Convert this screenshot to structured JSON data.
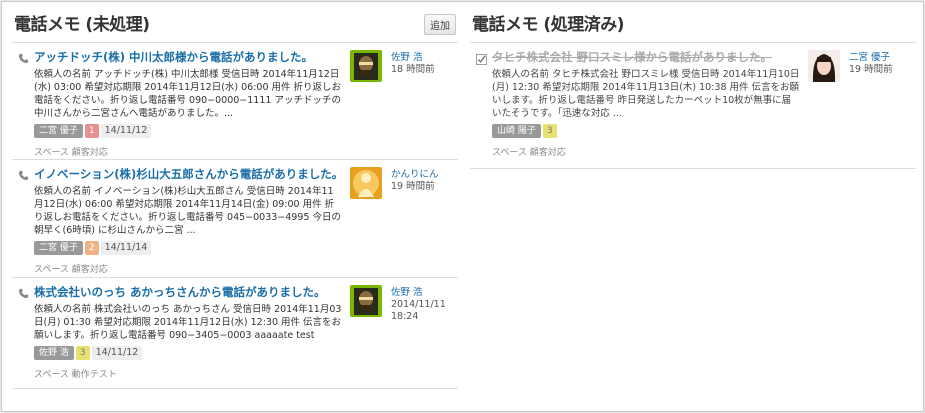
{
  "unprocessed": {
    "title": "電話メモ (未処理)",
    "add_label": "追加",
    "memos": [
      {
        "title": "アッチドッチ(株) 中川太郎様から電話がありました。",
        "text": "依頼人の名前 アッチドッチ(株) 中川太郎様 受信日時 2014年11月12日(水) 03:00 希望対応期限 2014年11月12日(水) 06:00 用件 折り返しお電話をください。折り返し電話番号 090−0000−1111 アッチドッチの中川さんから二宮さんへ電話がありました。...",
        "tag_user": "二宮 優子",
        "tag_count": "1",
        "tag_count_color": "#e89090",
        "tag_date": "14/11/12",
        "space_label": "スペース",
        "space_value": "顧客対応",
        "who_name": "佐野 浩",
        "who_time": "18 時間前"
      },
      {
        "title": "イノベーション(株)杉山大五郎さんから電話がありました。",
        "text": "依頼人の名前 イノベーション(株)杉山大五郎さん 受信日時 2014年11月12日(水) 06:00 希望対応期限 2014年11月14日(金) 09:00 用件 折り返しお電話をください。折り返し電話番号 045−0033−4995 今日の朝早く(6時頃) に杉山さんから二宮 ...",
        "tag_user": "二宮 優子",
        "tag_count": "2",
        "tag_count_color": "#f0b088",
        "tag_date": "14/11/14",
        "space_label": "スペース",
        "space_value": "顧客対応",
        "who_name": "かんりにん",
        "who_time": "19 時間前"
      },
      {
        "title": "株式会社いのっち あかっちさんから電話がありました。",
        "text": "依頼人の名前 株式会社いのっち あかっちさん 受信日時 2014年11月03日(月) 01:30 希望対応期限 2014年11月12日(水) 12:30 用件 伝言をお願いします。折り返し電話番号 090−3405−0003 aaaaate test",
        "tag_user": "佐野 浩",
        "tag_count": "3",
        "tag_count_color": "#e8e070",
        "tag_date": "14/11/12",
        "space_label": "スペース",
        "space_value": "動作テスト",
        "who_name": "佐野 浩",
        "who_time": "2014/11/11 18:24"
      }
    ]
  },
  "processed": {
    "title": "電話メモ (処理済み)",
    "memos": [
      {
        "title": "タヒチ株式会社 野口スミレ様から電話がありました。",
        "text": "依頼人の名前 タヒチ株式会社 野口スミレ様 受信日時 2014年11月10日(月) 12:30 希望対応期限 2014年11月13日(木) 10:38 用件 伝言をお願いします。折り返し電話番号 昨日発送したカーペット10枚が無事に届いたそうです。｢迅速な対応 ...",
        "tag_user": "山崎 陽子",
        "tag_count": "3",
        "tag_count_color": "#e8e070",
        "space_label": "スペース",
        "space_value": "顧客対応",
        "who_name": "二宮 優子",
        "who_time": "19 時間前"
      }
    ]
  },
  "icons": {
    "phone": "phone-icon",
    "check": "checkbox-checked-icon"
  }
}
